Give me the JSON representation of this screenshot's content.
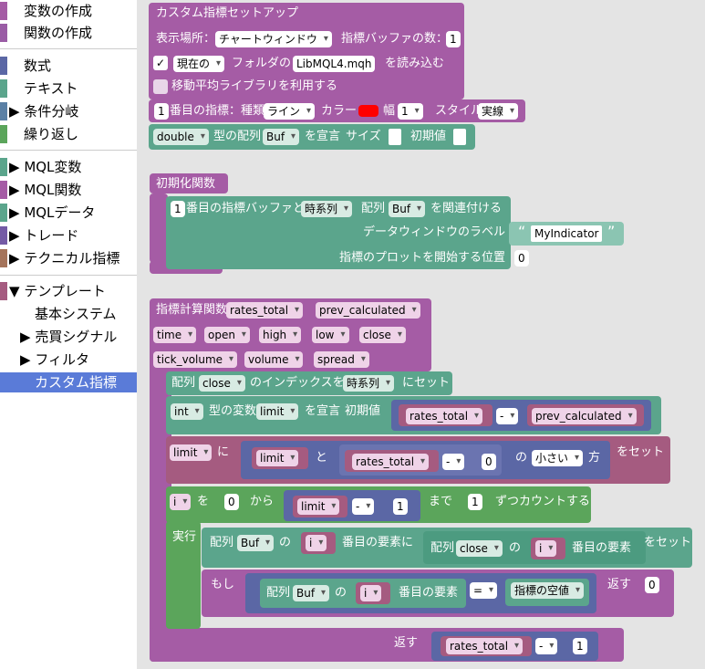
{
  "sidebar": {
    "items": [
      {
        "label": "変数の作成",
        "color": "#a55ca5"
      },
      {
        "label": "関数の作成",
        "color": "#9a5ca5"
      },
      {
        "label": "数式",
        "color": "#5b67a5"
      },
      {
        "label": "テキスト",
        "color": "#5ba58c"
      },
      {
        "label": "条件分岐",
        "color": "#5b80a5"
      },
      {
        "label": "繰り返し",
        "color": "#5ba55b"
      },
      {
        "label": "MQL変数",
        "color": "#5ba58c"
      },
      {
        "label": "MQL関数",
        "color": "#a55ca5"
      },
      {
        "label": "MQLデータ",
        "color": "#5ba58c"
      },
      {
        "label": "トレード",
        "color": "#745ba5"
      },
      {
        "label": "テクニカル指標",
        "color": "#a5745b"
      },
      {
        "label": "テンプレート",
        "color": "#a55b80"
      },
      {
        "label": "基本システム"
      },
      {
        "label": "売買シグナル"
      },
      {
        "label": "フィルタ"
      },
      {
        "label": "カスタム指標"
      }
    ]
  },
  "setup": {
    "title": "カスタム指標セットアップ",
    "display_label": "表示場所：",
    "display_value": "チャートウィンドウ",
    "buffer_count_label": "指標バッファの数：",
    "buffer_count": "1",
    "check1": "✓",
    "folder_value": "現在の",
    "folder_label": "フォルダの",
    "file_value": "LibMQL4.mqh",
    "load_label": "を読み込む",
    "ma_label": "移動平均ライブラリを利用する",
    "ind_num": "1",
    "ind_type_label": "番目の指標：種類",
    "ind_type_value": "ライン",
    "color_label": "カラー",
    "width_label": "幅",
    "width_value": "1",
    "style_label": "スタイル",
    "style_value": "実線",
    "arr_type": "double",
    "arr_label": "型の配列",
    "arr_name": "Buf",
    "declare_label": "を宣言",
    "size_label": "サイズ",
    "init_label": "初期値"
  },
  "init": {
    "title": "初期化関数",
    "num": "1",
    "label1": "番目の指標バッファと",
    "series_value": "時系列",
    "arr_label": "配列",
    "arr_name": "Buf",
    "link_label": "を関連付ける",
    "dw_label": "データウィンドウのラベル",
    "dw_value": "MyIndicator",
    "plot_label": "指標のプロットを開始する位置",
    "plot_value": "0",
    "quote_open": "“",
    "quote_close": "”"
  },
  "calc": {
    "title": "指標計算関数",
    "params": [
      "rates_total",
      "prev_calculated",
      "time",
      "open",
      "high",
      "low",
      "close",
      "tick_volume",
      "volume",
      "spread"
    ],
    "set_arr": "配列",
    "set_arr_name": "close",
    "set_index_label": "のインデックスを",
    "set_series": "時系列",
    "set_label": "にセット",
    "int_type": "int",
    "var_label": "型の変数",
    "var_name": "limit",
    "declare_label": "を宣言",
    "init_label": "初期値",
    "rt": "rates_total",
    "minus": "-",
    "pc": "prev_calculated",
    "limit_name": "limit",
    "ni_label": "に",
    "to_label": "と",
    "zero": "0",
    "no_label": "の",
    "smaller": "小さい",
    "kata_label": "方",
    "set_assign": "をセット",
    "loop_var": "i",
    "wo_label": "を",
    "from_value": "0",
    "kara_label": "から",
    "one": "1",
    "made_label": "まで",
    "step": "1",
    "count_label": "ずつカウントする",
    "exec_label": "実行",
    "buf_name": "Buf",
    "elem_label": "番目の要素に",
    "elem2_label": "番目の要素",
    "if_label": "もし",
    "eq": "=",
    "empty_value": "指標の空値",
    "return_label": "返す",
    "ret_value": "0",
    "return2_label": "返す"
  }
}
